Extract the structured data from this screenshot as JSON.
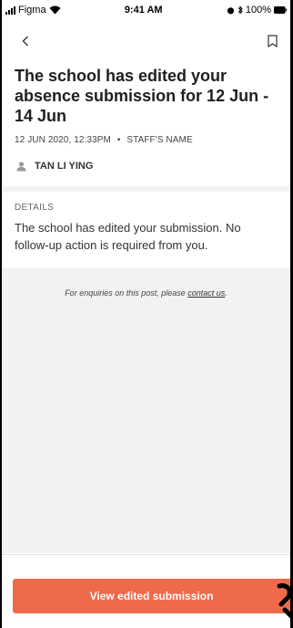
{
  "status_bar": {
    "carrier": "Figma",
    "time": "9:41 AM",
    "battery": "100%"
  },
  "nav": {
    "back_icon": "chevron-left-icon",
    "bookmark_icon": "bookmark-icon"
  },
  "post": {
    "title": "The school has edited your absence submission for 12 Jun - 14 Jun",
    "date": "12 JUN 2020, 12:33PM",
    "separator": "•",
    "staff": "STAFF'S NAME",
    "author": "TAN LI YING"
  },
  "details": {
    "label": "DETAILS",
    "body": "The school has edited your submission. No follow-up action is required from you."
  },
  "enquiry": {
    "prefix": "For enquiries on this post, please ",
    "link": "contact us",
    "suffix": "."
  },
  "cta": {
    "label": "View edited submission"
  },
  "colors": {
    "accent": "#ef6a4b",
    "grey_bg": "#f2f2f4"
  }
}
